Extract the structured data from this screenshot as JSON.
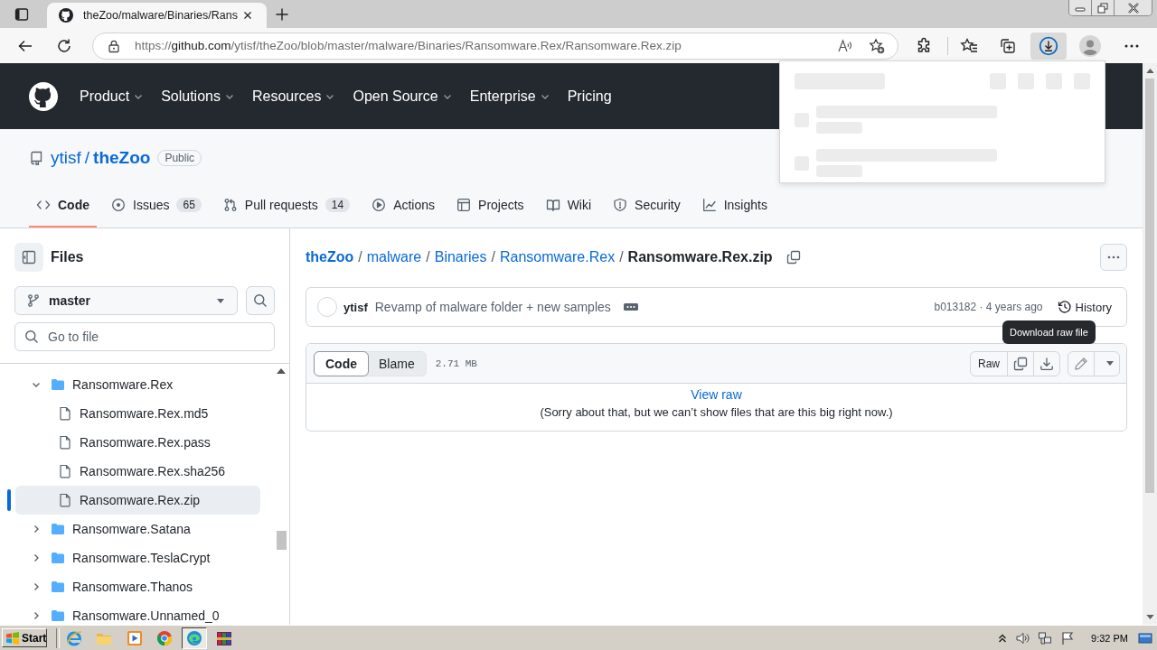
{
  "browser": {
    "tabs": [
      {
        "title": "theZoo/malware/Binaries/Rans",
        "selected": true
      }
    ],
    "address": {
      "scheme": "https://",
      "host": "github.com",
      "path": "/ytisf/theZoo/blob/master/malware/Binaries/Ransomware.Rex/Ransomware.Rex.zip"
    },
    "downloads_open": true
  },
  "header": {
    "nav": [
      {
        "label": "Product",
        "dropdown": true
      },
      {
        "label": "Solutions",
        "dropdown": true
      },
      {
        "label": "Resources",
        "dropdown": true
      },
      {
        "label": "Open Source",
        "dropdown": true
      },
      {
        "label": "Enterprise",
        "dropdown": true
      },
      {
        "label": "Pricing",
        "dropdown": false
      }
    ]
  },
  "repo": {
    "owner": "ytisf",
    "separator": "/",
    "name": "theZoo",
    "visibility": "Public",
    "tabs": [
      {
        "label": "Code",
        "selected": true
      },
      {
        "label": "Issues",
        "count": "65",
        "selected": false
      },
      {
        "label": "Pull requests",
        "count": "14",
        "selected": false
      },
      {
        "label": "Actions",
        "selected": false
      },
      {
        "label": "Projects",
        "selected": false
      },
      {
        "label": "Wiki",
        "selected": false
      },
      {
        "label": "Security",
        "selected": false
      },
      {
        "label": "Insights",
        "selected": false
      }
    ]
  },
  "sidebar": {
    "title": "Files",
    "branch": "master",
    "search": {
      "placeholder": "Go to file"
    },
    "tree": [
      {
        "kind": "folder",
        "name": "Ransomware.Rex",
        "expanded": true,
        "selected": false,
        "children": [
          {
            "kind": "file",
            "name": "Ransomware.Rex.md5",
            "selected": false
          },
          {
            "kind": "file",
            "name": "Ransomware.Rex.pass",
            "selected": false
          },
          {
            "kind": "file",
            "name": "Ransomware.Rex.sha256",
            "selected": false
          },
          {
            "kind": "file",
            "name": "Ransomware.Rex.zip",
            "selected": true
          }
        ]
      },
      {
        "kind": "folder",
        "name": "Ransomware.Satana",
        "expanded": false,
        "selected": false
      },
      {
        "kind": "folder",
        "name": "Ransomware.TeslaCrypt",
        "expanded": false,
        "selected": false
      },
      {
        "kind": "folder",
        "name": "Ransomware.Thanos",
        "expanded": false,
        "selected": false
      },
      {
        "kind": "folder",
        "name": "Ransomware.Unnamed_0",
        "expanded": false,
        "selected": false
      }
    ]
  },
  "file": {
    "path": [
      {
        "kind": "root",
        "text": "theZoo"
      },
      {
        "kind": "separator",
        "text": "/"
      },
      {
        "kind": "link",
        "text": "malware"
      },
      {
        "kind": "separator",
        "text": "/"
      },
      {
        "kind": "link",
        "text": "Binaries"
      },
      {
        "kind": "separator",
        "text": "/"
      },
      {
        "kind": "link",
        "text": "Ransomware.Rex"
      },
      {
        "kind": "separator",
        "text": "/"
      },
      {
        "kind": "current",
        "text": "Ransomware.Rex.zip"
      }
    ],
    "commit": {
      "author": "ytisf",
      "message": "Revamp of malware folder + new samples",
      "info": "b013182 · 4 years ago",
      "history": "History"
    },
    "views": [
      {
        "label": "Code",
        "selected": true
      },
      {
        "label": "Blame",
        "selected": false
      }
    ],
    "size": "2.71 MB",
    "raw": "Raw",
    "tooltip": "Download raw file",
    "view_raw": "View raw",
    "notice": "(Sorry about that, but we can’t show files that are this big right now.)"
  },
  "taskbar": {
    "start": "Start",
    "apps": [
      {
        "selected": false
      },
      {
        "selected": false
      },
      {
        "selected": false
      },
      {
        "selected": false
      },
      {
        "selected": true
      },
      {
        "selected": false
      }
    ],
    "clock": "9:32 PM"
  }
}
